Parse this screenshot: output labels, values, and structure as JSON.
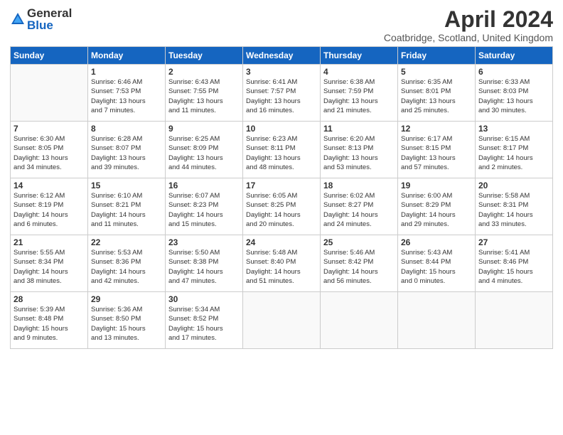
{
  "logo": {
    "general": "General",
    "blue": "Blue"
  },
  "header": {
    "month_title": "April 2024",
    "location": "Coatbridge, Scotland, United Kingdom"
  },
  "days_of_week": [
    "Sunday",
    "Monday",
    "Tuesday",
    "Wednesday",
    "Thursday",
    "Friday",
    "Saturday"
  ],
  "weeks": [
    [
      {
        "day": "",
        "info": ""
      },
      {
        "day": "1",
        "info": "Sunrise: 6:46 AM\nSunset: 7:53 PM\nDaylight: 13 hours\nand 7 minutes."
      },
      {
        "day": "2",
        "info": "Sunrise: 6:43 AM\nSunset: 7:55 PM\nDaylight: 13 hours\nand 11 minutes."
      },
      {
        "day": "3",
        "info": "Sunrise: 6:41 AM\nSunset: 7:57 PM\nDaylight: 13 hours\nand 16 minutes."
      },
      {
        "day": "4",
        "info": "Sunrise: 6:38 AM\nSunset: 7:59 PM\nDaylight: 13 hours\nand 21 minutes."
      },
      {
        "day": "5",
        "info": "Sunrise: 6:35 AM\nSunset: 8:01 PM\nDaylight: 13 hours\nand 25 minutes."
      },
      {
        "day": "6",
        "info": "Sunrise: 6:33 AM\nSunset: 8:03 PM\nDaylight: 13 hours\nand 30 minutes."
      }
    ],
    [
      {
        "day": "7",
        "info": "Sunrise: 6:30 AM\nSunset: 8:05 PM\nDaylight: 13 hours\nand 34 minutes."
      },
      {
        "day": "8",
        "info": "Sunrise: 6:28 AM\nSunset: 8:07 PM\nDaylight: 13 hours\nand 39 minutes."
      },
      {
        "day": "9",
        "info": "Sunrise: 6:25 AM\nSunset: 8:09 PM\nDaylight: 13 hours\nand 44 minutes."
      },
      {
        "day": "10",
        "info": "Sunrise: 6:23 AM\nSunset: 8:11 PM\nDaylight: 13 hours\nand 48 minutes."
      },
      {
        "day": "11",
        "info": "Sunrise: 6:20 AM\nSunset: 8:13 PM\nDaylight: 13 hours\nand 53 minutes."
      },
      {
        "day": "12",
        "info": "Sunrise: 6:17 AM\nSunset: 8:15 PM\nDaylight: 13 hours\nand 57 minutes."
      },
      {
        "day": "13",
        "info": "Sunrise: 6:15 AM\nSunset: 8:17 PM\nDaylight: 14 hours\nand 2 minutes."
      }
    ],
    [
      {
        "day": "14",
        "info": "Sunrise: 6:12 AM\nSunset: 8:19 PM\nDaylight: 14 hours\nand 6 minutes."
      },
      {
        "day": "15",
        "info": "Sunrise: 6:10 AM\nSunset: 8:21 PM\nDaylight: 14 hours\nand 11 minutes."
      },
      {
        "day": "16",
        "info": "Sunrise: 6:07 AM\nSunset: 8:23 PM\nDaylight: 14 hours\nand 15 minutes."
      },
      {
        "day": "17",
        "info": "Sunrise: 6:05 AM\nSunset: 8:25 PM\nDaylight: 14 hours\nand 20 minutes."
      },
      {
        "day": "18",
        "info": "Sunrise: 6:02 AM\nSunset: 8:27 PM\nDaylight: 14 hours\nand 24 minutes."
      },
      {
        "day": "19",
        "info": "Sunrise: 6:00 AM\nSunset: 8:29 PM\nDaylight: 14 hours\nand 29 minutes."
      },
      {
        "day": "20",
        "info": "Sunrise: 5:58 AM\nSunset: 8:31 PM\nDaylight: 14 hours\nand 33 minutes."
      }
    ],
    [
      {
        "day": "21",
        "info": "Sunrise: 5:55 AM\nSunset: 8:34 PM\nDaylight: 14 hours\nand 38 minutes."
      },
      {
        "day": "22",
        "info": "Sunrise: 5:53 AM\nSunset: 8:36 PM\nDaylight: 14 hours\nand 42 minutes."
      },
      {
        "day": "23",
        "info": "Sunrise: 5:50 AM\nSunset: 8:38 PM\nDaylight: 14 hours\nand 47 minutes."
      },
      {
        "day": "24",
        "info": "Sunrise: 5:48 AM\nSunset: 8:40 PM\nDaylight: 14 hours\nand 51 minutes."
      },
      {
        "day": "25",
        "info": "Sunrise: 5:46 AM\nSunset: 8:42 PM\nDaylight: 14 hours\nand 56 minutes."
      },
      {
        "day": "26",
        "info": "Sunrise: 5:43 AM\nSunset: 8:44 PM\nDaylight: 15 hours\nand 0 minutes."
      },
      {
        "day": "27",
        "info": "Sunrise: 5:41 AM\nSunset: 8:46 PM\nDaylight: 15 hours\nand 4 minutes."
      }
    ],
    [
      {
        "day": "28",
        "info": "Sunrise: 5:39 AM\nSunset: 8:48 PM\nDaylight: 15 hours\nand 9 minutes."
      },
      {
        "day": "29",
        "info": "Sunrise: 5:36 AM\nSunset: 8:50 PM\nDaylight: 15 hours\nand 13 minutes."
      },
      {
        "day": "30",
        "info": "Sunrise: 5:34 AM\nSunset: 8:52 PM\nDaylight: 15 hours\nand 17 minutes."
      },
      {
        "day": "",
        "info": ""
      },
      {
        "day": "",
        "info": ""
      },
      {
        "day": "",
        "info": ""
      },
      {
        "day": "",
        "info": ""
      }
    ]
  ]
}
